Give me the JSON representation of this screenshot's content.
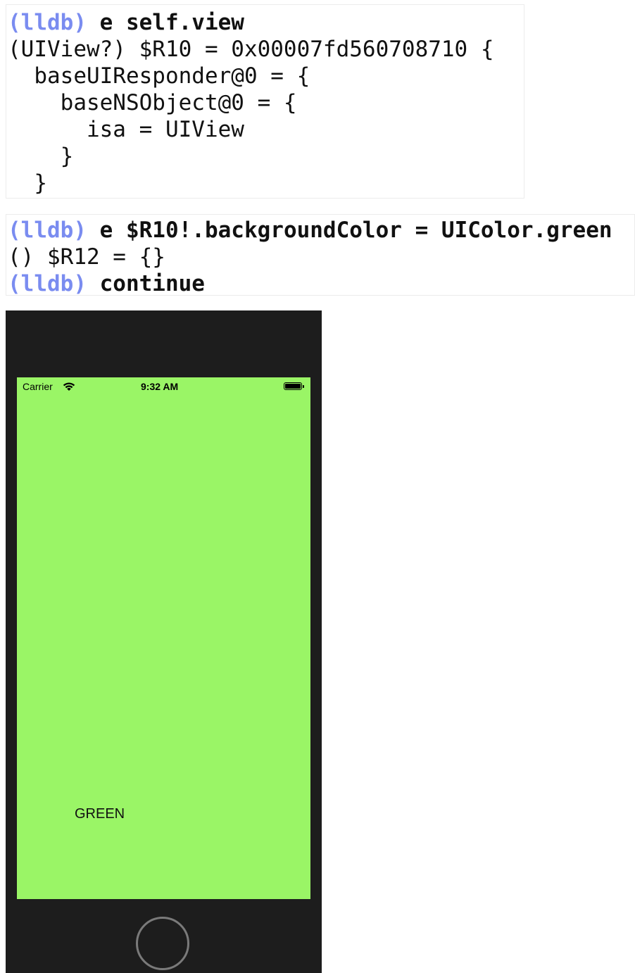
{
  "console_top": {
    "lines": [
      {
        "prompt": "(lldb)",
        "command": " e self.view"
      },
      {
        "text": "(UIView?) $R10 = 0x00007fd560708710 {"
      },
      {
        "text": "  baseUIResponder@0 = {"
      },
      {
        "text": "    baseNSObject@0 = {"
      },
      {
        "text": "      isa = UIView"
      },
      {
        "text": "    }"
      },
      {
        "text": "  }"
      }
    ]
  },
  "console_bottom": {
    "lines": [
      {
        "prompt": "(lldb)",
        "command": " e $R10!.backgroundColor = UIColor.green"
      },
      {
        "text": "() $R12 = {}"
      },
      {
        "prompt": "(lldb)",
        "command": " continue"
      }
    ]
  },
  "simulator": {
    "carrier": "Carrier",
    "time": "9:32 AM",
    "label": "GREEN",
    "screen_color": "#9af566",
    "icons": [
      "wifi-icon",
      "battery-icon",
      "home-button"
    ]
  },
  "colors": {
    "prompt": "#7a8cf0",
    "device_frame": "#1d1d1d"
  }
}
